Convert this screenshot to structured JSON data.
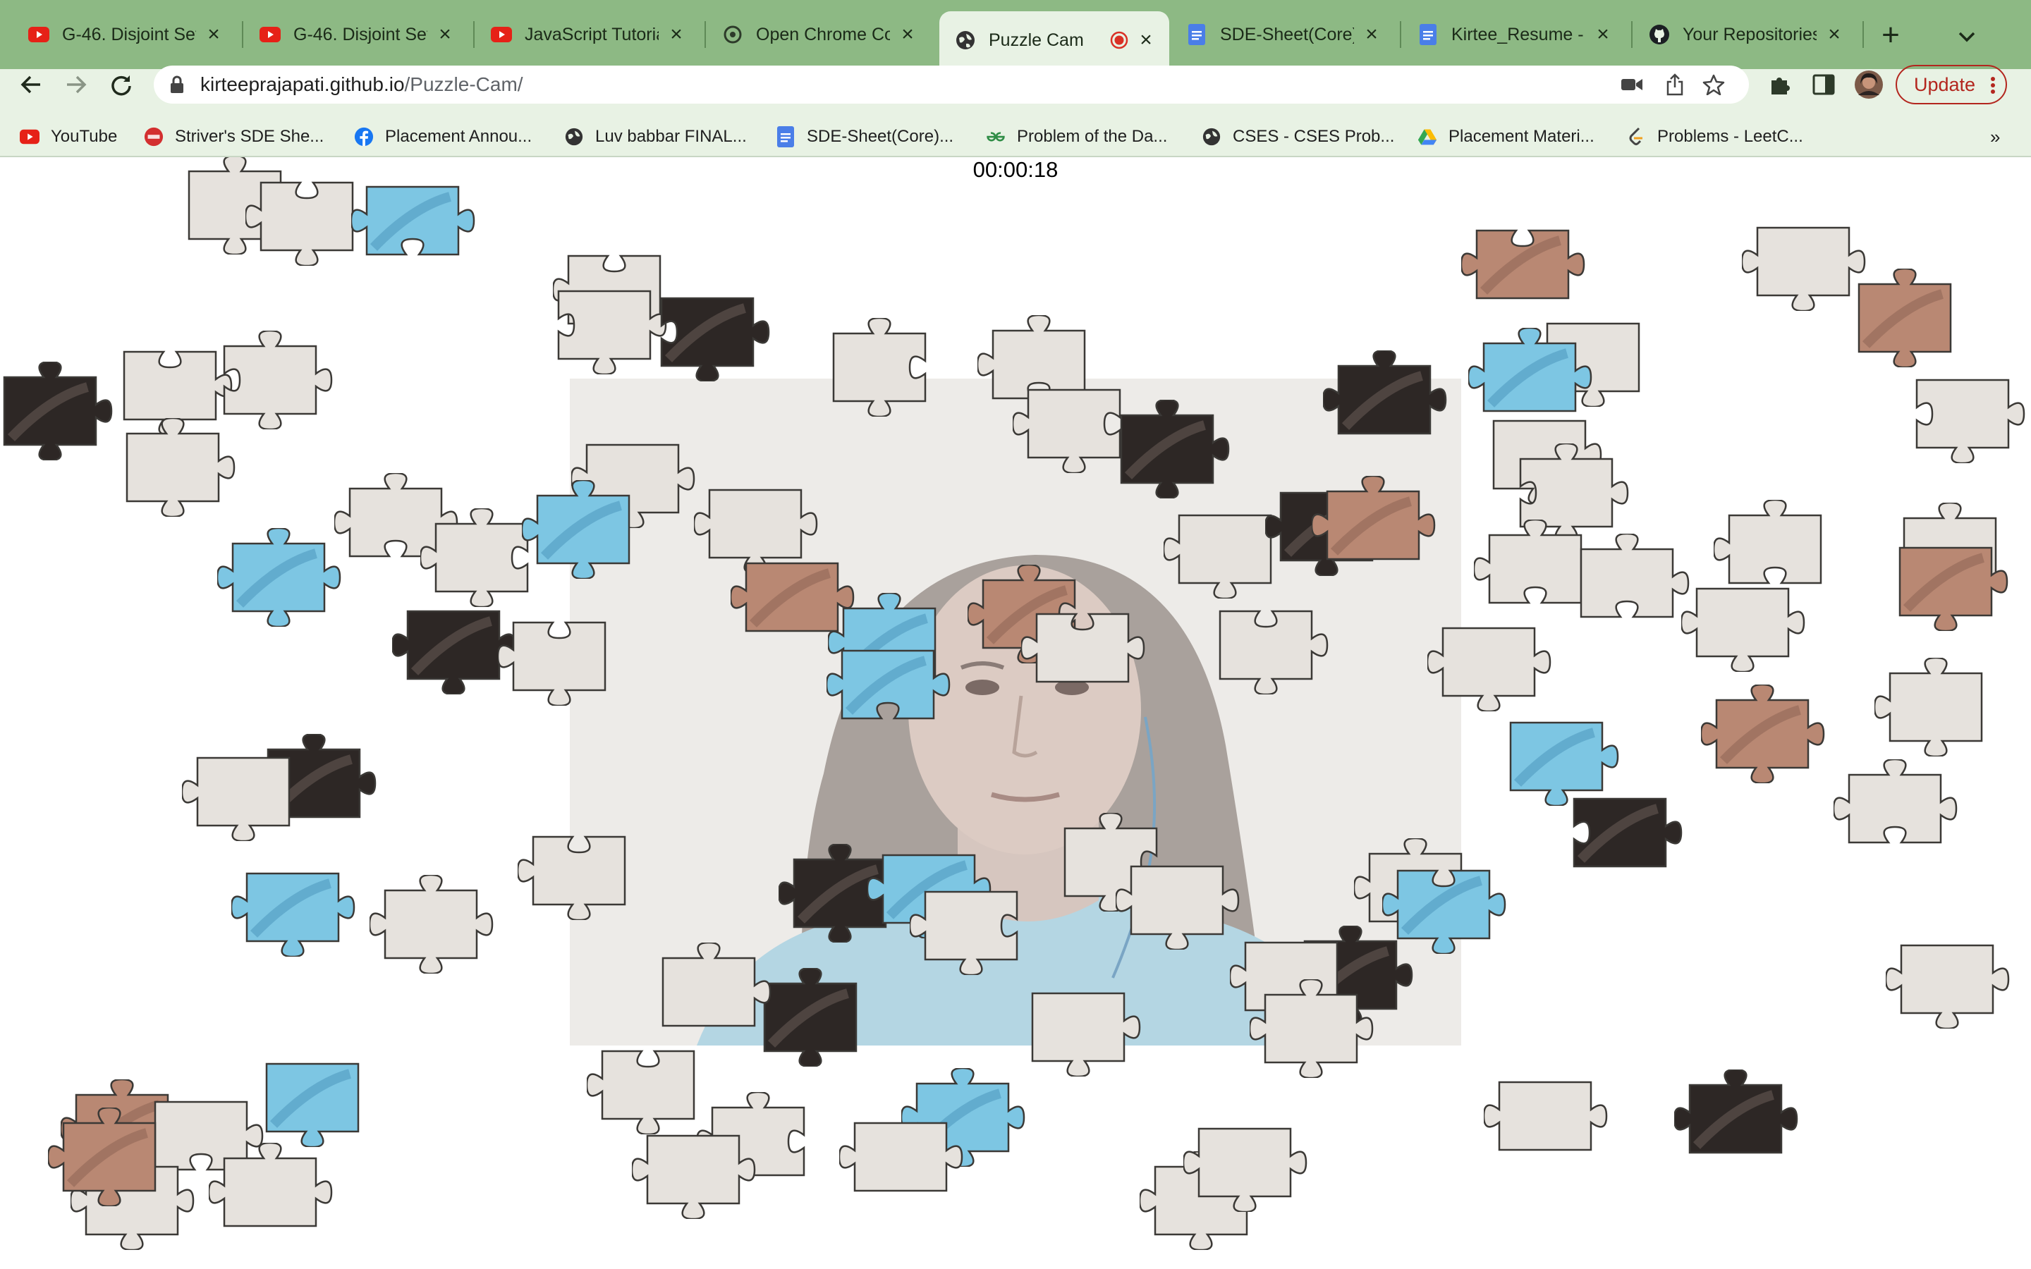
{
  "tabs": [
    {
      "title": "G-46. Disjoint Set",
      "favicon": "youtube-icon"
    },
    {
      "title": "G-46. Disjoint Set",
      "favicon": "youtube-icon"
    },
    {
      "title": "JavaScript Tutorial",
      "favicon": "youtube-icon"
    },
    {
      "title": "Open Chrome Con",
      "favicon": "openai-icon"
    },
    {
      "title": "Puzzle Cam",
      "favicon": "globe-icon",
      "active": true,
      "recording": true
    },
    {
      "title": "SDE-Sheet(Core)",
      "favicon": "docs-icon"
    },
    {
      "title": "Kirtee_Resume -",
      "favicon": "docs-icon"
    },
    {
      "title": "Your Repositories",
      "favicon": "github-icon"
    }
  ],
  "toolbar": {
    "url_host": "kirteeprajapati.github.io",
    "url_path": "/Puzzle-Cam/",
    "update_label": "Update"
  },
  "bookmarks": [
    {
      "label": "YouTube",
      "icon": "youtube-icon"
    },
    {
      "label": "Striver's SDE She...",
      "icon": "tuf-icon"
    },
    {
      "label": "Placement Annou...",
      "icon": "facebook-icon"
    },
    {
      "label": "Luv babbar FINAL...",
      "icon": "globe-icon"
    },
    {
      "label": "SDE-Sheet(Core)...",
      "icon": "docs-icon"
    },
    {
      "label": "Problem of the Da...",
      "icon": "gfg-icon"
    },
    {
      "label": "CSES - CSES Prob...",
      "icon": "globe-icon"
    },
    {
      "label": "Placement Materi...",
      "icon": "drive-icon"
    },
    {
      "label": "Problems - LeetC...",
      "icon": "leetcode-icon"
    }
  ],
  "page": {
    "timer": "00:00:18"
  },
  "colors": {
    "tabstrip": "#8db984",
    "toolbar": "#e8f2e4",
    "piece_blank": "#e6e2dd",
    "piece_blue": "#7dc6e3",
    "piece_skin": "#b98873",
    "piece_dark": "#2d2725"
  }
}
